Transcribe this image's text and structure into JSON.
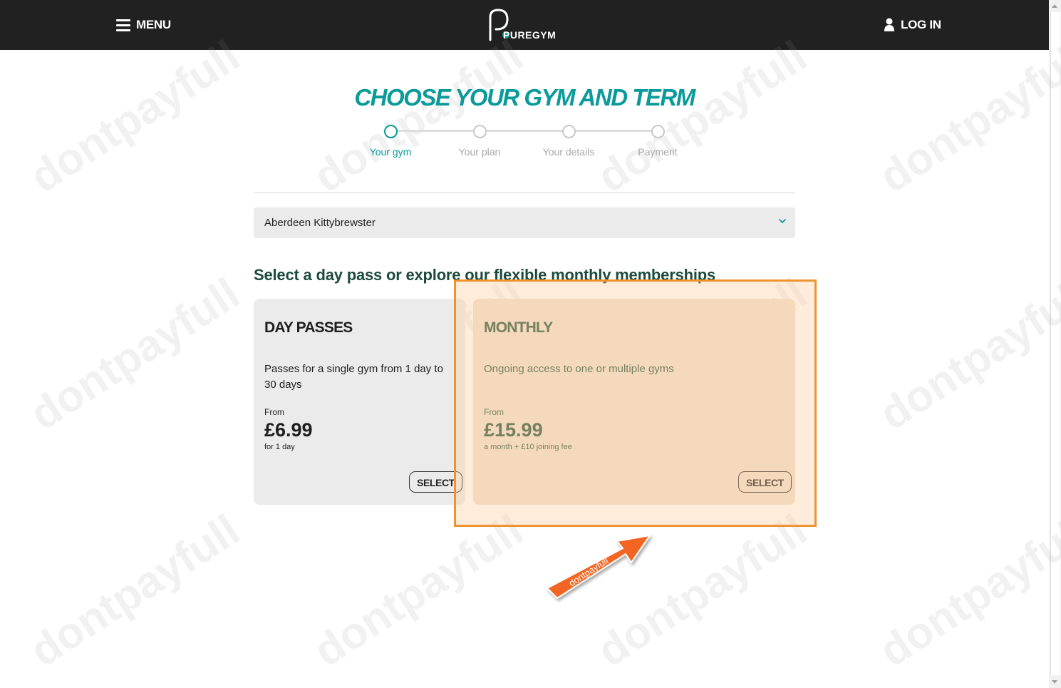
{
  "header": {
    "menu_label": "MENU",
    "login_label": "LOG IN",
    "logo_text": "PUREGYM"
  },
  "page": {
    "title": "CHOOSE YOUR GYM AND TERM",
    "steps": [
      {
        "label": "Your gym",
        "active": true
      },
      {
        "label": "Your plan",
        "active": false
      },
      {
        "label": "Your details",
        "active": false
      },
      {
        "label": "Payment",
        "active": false
      }
    ]
  },
  "gym_select": {
    "value": "Aberdeen Kittybrewster"
  },
  "section_heading": "Select a day pass or explore our flexible monthly memberships",
  "cards": {
    "day": {
      "title": "DAY PASSES",
      "description": "Passes for a single gym from 1 day to 30 days",
      "from_label": "From",
      "price": "£6.99",
      "sub": "for 1 day",
      "button": "SELECT"
    },
    "monthly": {
      "title": "MONTHLY",
      "description": "Ongoing access to one or multiple gyms",
      "from_label": "From",
      "price": "£15.99",
      "sub": "a month + £10 joining fee",
      "button": "SELECT"
    }
  },
  "watermark": {
    "text": "dontpayfull",
    "arrow_text": "dontpayfull"
  },
  "colors": {
    "header_bg": "#212121",
    "accent_teal": "#0a9a9a",
    "heading_green": "#1d4a3e",
    "highlight_orange": "#ef9330"
  }
}
